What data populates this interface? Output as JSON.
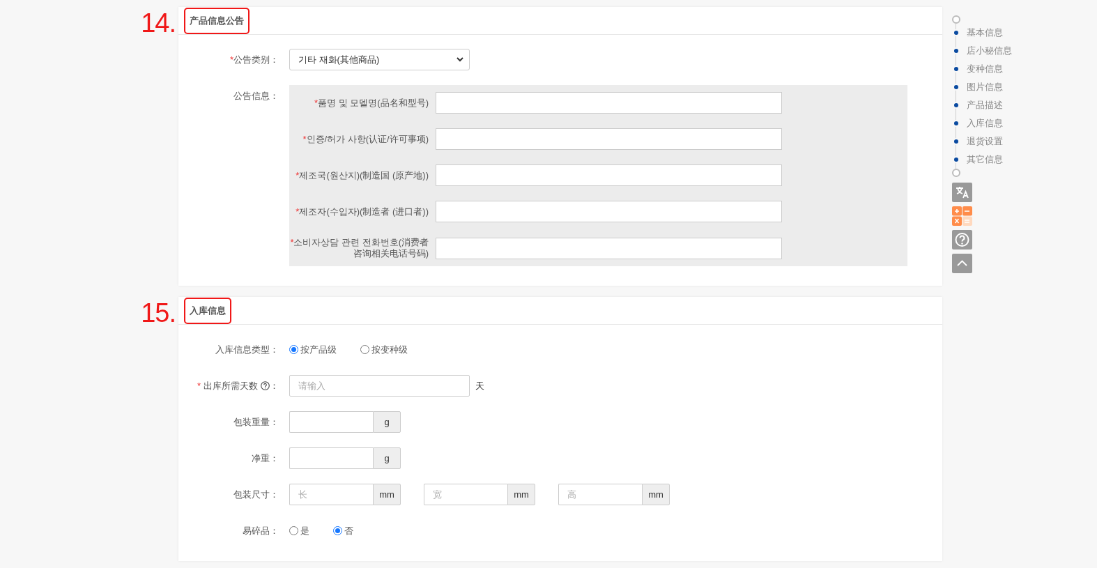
{
  "sections": [
    {
      "number": "14.",
      "title": "产品信息公告",
      "fields": [
        {
          "kind": "select",
          "required_mark": "*",
          "label": "公告类别：",
          "value": "기타 재화(其他商品)"
        },
        {
          "kind": "group",
          "label": "公告信息：",
          "items": [
            {
              "required_mark": "*",
              "label": "품명 및 모델명(品名和型号)"
            },
            {
              "required_mark": "*",
              "label": "인증/허가 사항(认证/许可事项)"
            },
            {
              "required_mark": "*",
              "label": "제조국(원산지)(制造国 (原产地))"
            },
            {
              "required_mark": "*",
              "label": "제조자(수입자)(制造者 (进口者))"
            },
            {
              "required_mark": "*",
              "label": "소비자상담 관련 전화번호(消费者咨询相关电话号码)"
            }
          ]
        }
      ]
    },
    {
      "number": "15.",
      "title": "入库信息",
      "fields": [
        {
          "kind": "radio",
          "label": "入库信息类型：",
          "options": [
            {
              "label": "按产品级",
              "selected": true
            },
            {
              "label": "按变种级",
              "selected": false
            }
          ]
        },
        {
          "kind": "text",
          "required_mark": "*",
          "label": "出库所需天数",
          "help": true,
          "label_end": "：",
          "placeholder": "请输入",
          "suffix": "天"
        },
        {
          "kind": "units",
          "label": "包装重量：",
          "inputs": [
            {
              "unit": "g"
            }
          ]
        },
        {
          "kind": "units",
          "label": "净重：",
          "inputs": [
            {
              "unit": "g"
            }
          ]
        },
        {
          "kind": "units",
          "label": "包装尺寸：",
          "inputs": [
            {
              "placeholder": "长",
              "unit": "mm"
            },
            {
              "placeholder": "宽",
              "unit": "mm"
            },
            {
              "placeholder": "高",
              "unit": "mm"
            }
          ]
        },
        {
          "kind": "radio",
          "label": "易碎品：",
          "options": [
            {
              "label": "是",
              "selected": false
            },
            {
              "label": "否",
              "selected": true
            }
          ]
        }
      ]
    }
  ],
  "nav": {
    "items": [
      {
        "label": "基本信息",
        "color": "#0a4aa0"
      },
      {
        "label": "店小秘信息",
        "color": "#0a4aa0"
      },
      {
        "label": "变种信息",
        "color": "#0a4aa0"
      },
      {
        "label": "图片信息",
        "color": "#0a4aa0"
      },
      {
        "label": "产品描述",
        "color": "#0a4aa0"
      },
      {
        "label": "入库信息",
        "color": "#0a4aa0"
      },
      {
        "label": "退货设置",
        "color": "#0a4aa0"
      },
      {
        "label": "其它信息",
        "color": "#0a4aa0"
      }
    ],
    "tools": [
      {
        "kind": "translate"
      },
      {
        "kind": "calculator"
      },
      {
        "kind": "help"
      },
      {
        "kind": "top"
      }
    ]
  }
}
